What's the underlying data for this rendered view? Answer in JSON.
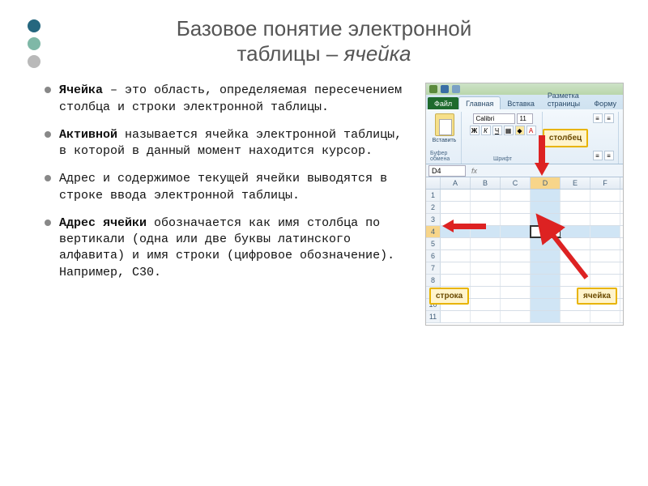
{
  "title": {
    "line1": "Базовое понятие электронной",
    "line2_prefix": "таблицы – ",
    "line2_italic": "ячейка"
  },
  "bullets": [
    {
      "bold": "Ячейка",
      "rest": " – это область, определяемая пересечением столбца и строки электронной таблицы."
    },
    {
      "bold": "Активной",
      "rest": " называется ячейка электронной таблицы, в которой в данный момент находится курсор."
    },
    {
      "bold": "",
      "rest": "Адрес и содержимое текущей ячейки выводятся в строке ввода электронной таблицы."
    },
    {
      "bold": "Адрес ячейки",
      "rest": " обозначается как имя столбца по вертикали (одна или две буквы латинского алфавита) и имя строки (цифровое обозначение). Например, С30."
    }
  ],
  "excel": {
    "tabs": {
      "file": "Файл",
      "home": "Главная",
      "insert": "Вставка",
      "layout": "Разметка страницы",
      "formulas": "Форму"
    },
    "ribbon": {
      "paste_label": "Вставить",
      "clipboard_group": "Буфер обмена",
      "font_name": "Calibri",
      "font_size": "11",
      "font_group": "Шрифт"
    },
    "namebox": "D4",
    "columns": [
      "A",
      "B",
      "C",
      "D",
      "E",
      "F"
    ],
    "rows": [
      "1",
      "2",
      "3",
      "4",
      "5",
      "6",
      "7",
      "8",
      "9",
      "10",
      "11"
    ],
    "selected_col": "D",
    "selected_row": "4",
    "callouts": {
      "column": "столбец",
      "row": "строка",
      "cell": "ячейка"
    }
  }
}
